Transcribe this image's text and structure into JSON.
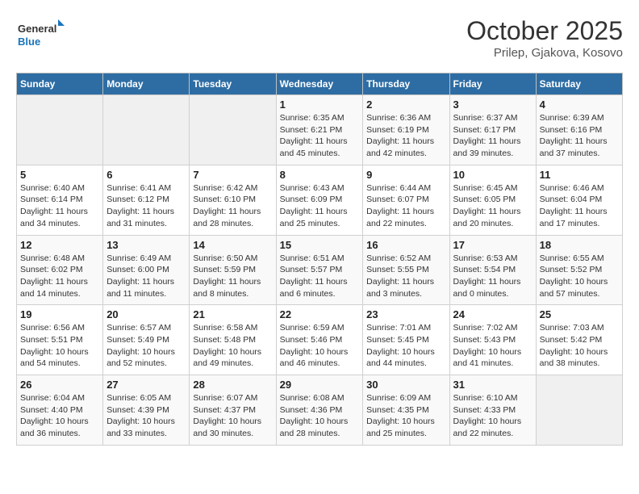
{
  "header": {
    "logo_line1": "General",
    "logo_line2": "Blue",
    "month": "October 2025",
    "location": "Prilep, Gjakova, Kosovo"
  },
  "weekdays": [
    "Sunday",
    "Monday",
    "Tuesday",
    "Wednesday",
    "Thursday",
    "Friday",
    "Saturday"
  ],
  "weeks": [
    [
      {
        "day": "",
        "info": ""
      },
      {
        "day": "",
        "info": ""
      },
      {
        "day": "",
        "info": ""
      },
      {
        "day": "1",
        "info": "Sunrise: 6:35 AM\nSunset: 6:21 PM\nDaylight: 11 hours\nand 45 minutes."
      },
      {
        "day": "2",
        "info": "Sunrise: 6:36 AM\nSunset: 6:19 PM\nDaylight: 11 hours\nand 42 minutes."
      },
      {
        "day": "3",
        "info": "Sunrise: 6:37 AM\nSunset: 6:17 PM\nDaylight: 11 hours\nand 39 minutes."
      },
      {
        "day": "4",
        "info": "Sunrise: 6:39 AM\nSunset: 6:16 PM\nDaylight: 11 hours\nand 37 minutes."
      }
    ],
    [
      {
        "day": "5",
        "info": "Sunrise: 6:40 AM\nSunset: 6:14 PM\nDaylight: 11 hours\nand 34 minutes."
      },
      {
        "day": "6",
        "info": "Sunrise: 6:41 AM\nSunset: 6:12 PM\nDaylight: 11 hours\nand 31 minutes."
      },
      {
        "day": "7",
        "info": "Sunrise: 6:42 AM\nSunset: 6:10 PM\nDaylight: 11 hours\nand 28 minutes."
      },
      {
        "day": "8",
        "info": "Sunrise: 6:43 AM\nSunset: 6:09 PM\nDaylight: 11 hours\nand 25 minutes."
      },
      {
        "day": "9",
        "info": "Sunrise: 6:44 AM\nSunset: 6:07 PM\nDaylight: 11 hours\nand 22 minutes."
      },
      {
        "day": "10",
        "info": "Sunrise: 6:45 AM\nSunset: 6:05 PM\nDaylight: 11 hours\nand 20 minutes."
      },
      {
        "day": "11",
        "info": "Sunrise: 6:46 AM\nSunset: 6:04 PM\nDaylight: 11 hours\nand 17 minutes."
      }
    ],
    [
      {
        "day": "12",
        "info": "Sunrise: 6:48 AM\nSunset: 6:02 PM\nDaylight: 11 hours\nand 14 minutes."
      },
      {
        "day": "13",
        "info": "Sunrise: 6:49 AM\nSunset: 6:00 PM\nDaylight: 11 hours\nand 11 minutes."
      },
      {
        "day": "14",
        "info": "Sunrise: 6:50 AM\nSunset: 5:59 PM\nDaylight: 11 hours\nand 8 minutes."
      },
      {
        "day": "15",
        "info": "Sunrise: 6:51 AM\nSunset: 5:57 PM\nDaylight: 11 hours\nand 6 minutes."
      },
      {
        "day": "16",
        "info": "Sunrise: 6:52 AM\nSunset: 5:55 PM\nDaylight: 11 hours\nand 3 minutes."
      },
      {
        "day": "17",
        "info": "Sunrise: 6:53 AM\nSunset: 5:54 PM\nDaylight: 11 hours\nand 0 minutes."
      },
      {
        "day": "18",
        "info": "Sunrise: 6:55 AM\nSunset: 5:52 PM\nDaylight: 10 hours\nand 57 minutes."
      }
    ],
    [
      {
        "day": "19",
        "info": "Sunrise: 6:56 AM\nSunset: 5:51 PM\nDaylight: 10 hours\nand 54 minutes."
      },
      {
        "day": "20",
        "info": "Sunrise: 6:57 AM\nSunset: 5:49 PM\nDaylight: 10 hours\nand 52 minutes."
      },
      {
        "day": "21",
        "info": "Sunrise: 6:58 AM\nSunset: 5:48 PM\nDaylight: 10 hours\nand 49 minutes."
      },
      {
        "day": "22",
        "info": "Sunrise: 6:59 AM\nSunset: 5:46 PM\nDaylight: 10 hours\nand 46 minutes."
      },
      {
        "day": "23",
        "info": "Sunrise: 7:01 AM\nSunset: 5:45 PM\nDaylight: 10 hours\nand 44 minutes."
      },
      {
        "day": "24",
        "info": "Sunrise: 7:02 AM\nSunset: 5:43 PM\nDaylight: 10 hours\nand 41 minutes."
      },
      {
        "day": "25",
        "info": "Sunrise: 7:03 AM\nSunset: 5:42 PM\nDaylight: 10 hours\nand 38 minutes."
      }
    ],
    [
      {
        "day": "26",
        "info": "Sunrise: 6:04 AM\nSunset: 4:40 PM\nDaylight: 10 hours\nand 36 minutes."
      },
      {
        "day": "27",
        "info": "Sunrise: 6:05 AM\nSunset: 4:39 PM\nDaylight: 10 hours\nand 33 minutes."
      },
      {
        "day": "28",
        "info": "Sunrise: 6:07 AM\nSunset: 4:37 PM\nDaylight: 10 hours\nand 30 minutes."
      },
      {
        "day": "29",
        "info": "Sunrise: 6:08 AM\nSunset: 4:36 PM\nDaylight: 10 hours\nand 28 minutes."
      },
      {
        "day": "30",
        "info": "Sunrise: 6:09 AM\nSunset: 4:35 PM\nDaylight: 10 hours\nand 25 minutes."
      },
      {
        "day": "31",
        "info": "Sunrise: 6:10 AM\nSunset: 4:33 PM\nDaylight: 10 hours\nand 22 minutes."
      },
      {
        "day": "",
        "info": ""
      }
    ]
  ]
}
